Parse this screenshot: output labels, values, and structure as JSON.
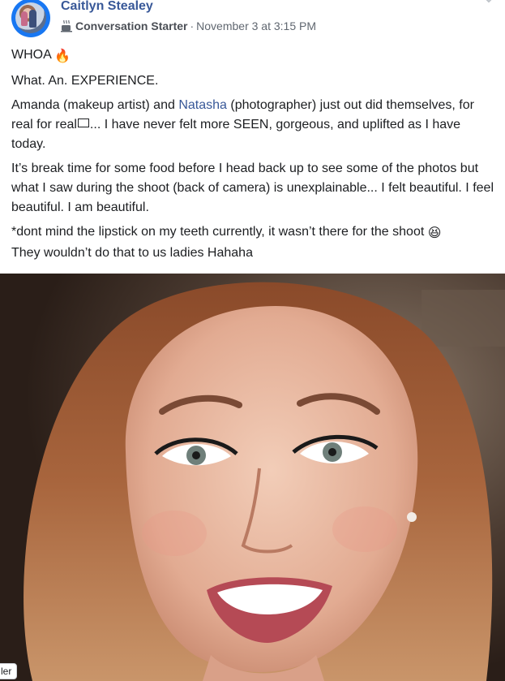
{
  "post": {
    "author": "Caitlyn Stealey",
    "badge_icon": "coffee-cup-icon",
    "badge": "Conversation Starter",
    "separator": "·",
    "timestamp": "November 3 at 3:15 PM",
    "paragraphs": {
      "p1_text": "WHOA",
      "p1_emoji": "🔥",
      "p2": "What. An. EXPERIENCE.",
      "p3_a": "Amanda (makeup artist) and ",
      "p3_mention": "Natasha",
      "p3_b": " (photographer) just out did themselves, for real for real",
      "p3_c": "... I have never felt more SEEN, gorgeous, and uplifted as I have today.",
      "p4": "It’s break time for some food before I head back up to see some of the photos but what I saw during the shoot (back of camera) is unexplainable... I felt beautiful. I feel beautiful. I am beautiful.",
      "p5_a": "*dont mind the lipstick on my teeth currently, it wasn’t there for the shoot",
      "p5_emoji": "😆",
      "p5_b": "They wouldn’t do that to us ladies Hahaha"
    },
    "photo_alt_icon": "portrait-photo",
    "corner_label": "ler"
  },
  "colors": {
    "link": "#385898",
    "text": "#1c1e21",
    "meta": "#606770"
  }
}
